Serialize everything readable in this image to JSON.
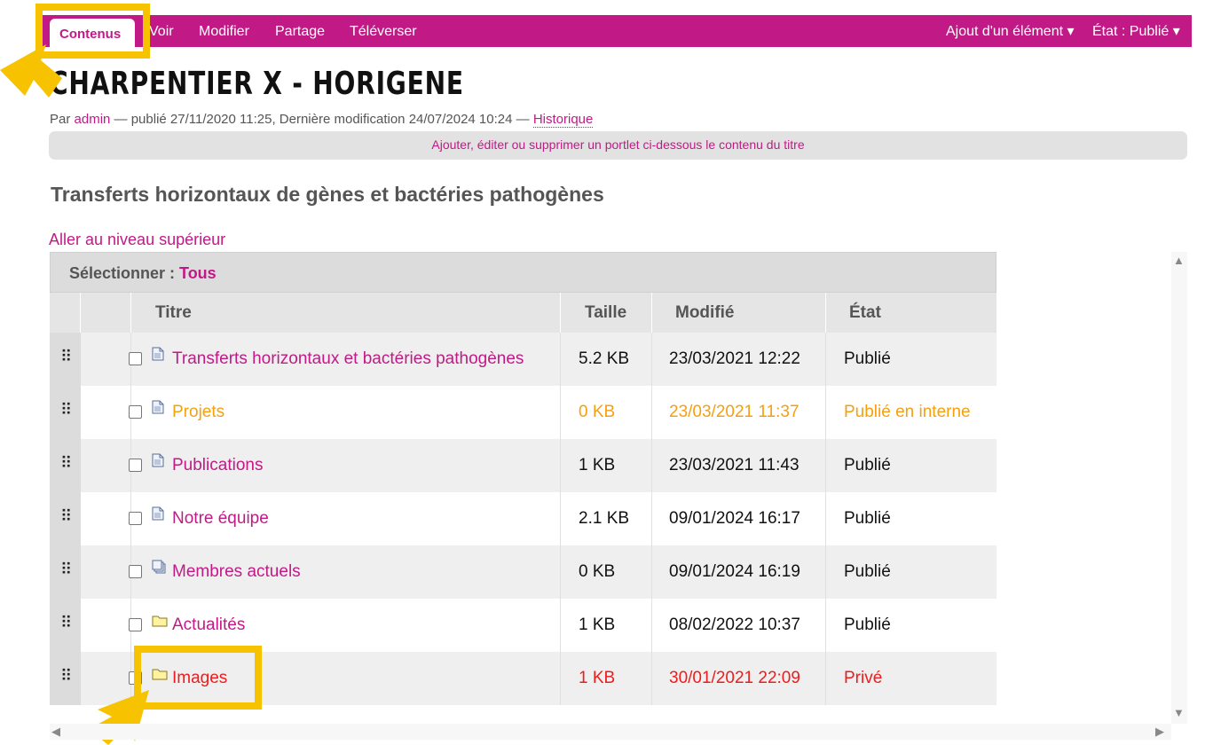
{
  "toolbar": {
    "tabs": [
      "Contenus",
      "Voir",
      "Modifier",
      "Partage",
      "Téléverser"
    ],
    "add_item": "Ajout d'un élément ▾",
    "state": "État : Publié ▾"
  },
  "page": {
    "title": "CHARPENTIER X - HORIGENE",
    "byline": {
      "by": "Par ",
      "author": "admin",
      "published": " — publié 27/11/2020 11:25, Dernière modification 24/07/2024 10:24 — ",
      "history": "Historique"
    },
    "portlet_hint": "Ajouter, éditer ou supprimer un portlet ci-dessous le contenu du titre",
    "section_heading": "Transferts horizontaux de gènes et bactéries pathogènes",
    "up_link": "Aller au niveau supérieur"
  },
  "listing": {
    "select_label": "Sélectionner : ",
    "select_all": "Tous",
    "columns": [
      "Titre",
      "Taille",
      "Modifié",
      "État"
    ],
    "drag_glyph": "⠿",
    "rows": [
      {
        "title": "Transferts horizontaux et bactéries pathogènes",
        "size": "5.2 KB",
        "modified": "23/03/2021 12:22",
        "state": "Publié",
        "icon": "document-icon",
        "tone": "published"
      },
      {
        "title": "Projets",
        "size": "0 KB",
        "modified": "23/03/2021 11:37",
        "state": "Publié en interne",
        "icon": "document-icon",
        "tone": "internal"
      },
      {
        "title": "Publications",
        "size": "1 KB",
        "modified": "23/03/2021 11:43",
        "state": "Publié",
        "icon": "document-icon",
        "tone": "published"
      },
      {
        "title": "Notre équipe",
        "size": "2.1 KB",
        "modified": "09/01/2024 16:17",
        "state": "Publié",
        "icon": "document-icon",
        "tone": "published"
      },
      {
        "title": "Membres actuels",
        "size": "0 KB",
        "modified": "09/01/2024 16:19",
        "state": "Publié",
        "icon": "collection-icon",
        "tone": "published"
      },
      {
        "title": "Actualités",
        "size": "1 KB",
        "modified": "08/02/2022 10:37",
        "state": "Publié",
        "icon": "folder-icon",
        "tone": "published"
      },
      {
        "title": "Images",
        "size": "1 KB",
        "modified": "30/01/2021 22:09",
        "state": "Privé",
        "icon": "folder-icon",
        "tone": "private"
      }
    ]
  },
  "scrollbars": {
    "up": "▲",
    "down": "▼",
    "left": "◀",
    "right": "▶"
  },
  "colors": {
    "brand": "#c11a86",
    "highlight": "#f7c300",
    "internal_state": "#f5a00f",
    "private_state": "#ee1c1c"
  }
}
